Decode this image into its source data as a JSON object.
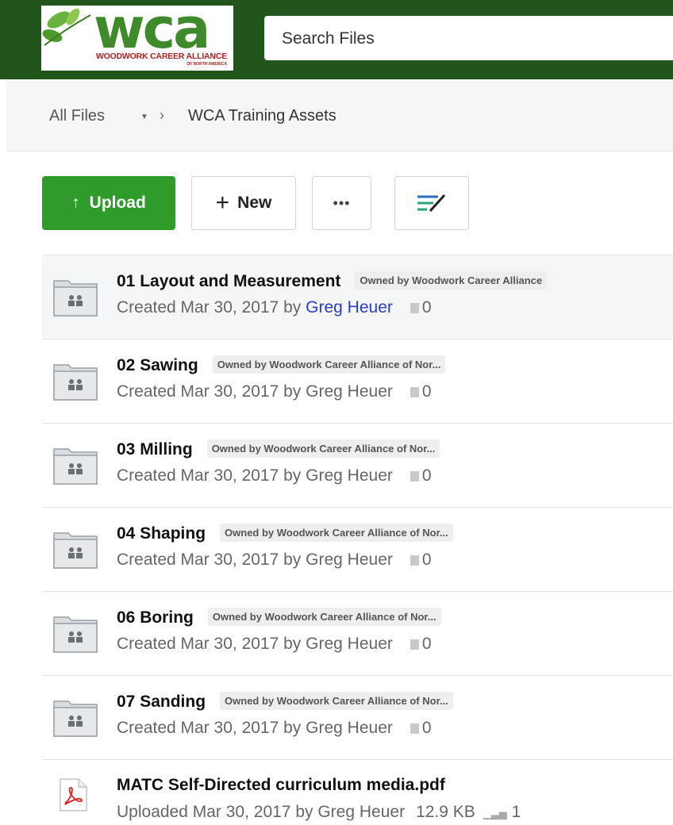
{
  "header": {
    "logo_text": "wca",
    "logo_subtitle": "WOODWORK CAREER ALLIANCE",
    "logo_subtitle2": "OF NORTH AMERICA",
    "search_placeholder": "Search Files",
    "brand_color": "#22551c"
  },
  "breadcrumb": {
    "root": "All Files",
    "separator": "›",
    "current": "WCA Training Assets"
  },
  "toolbar": {
    "upload_label": "Upload",
    "new_label": "New",
    "more_label": "•••"
  },
  "items": [
    {
      "name": "01 Layout and Measurement",
      "owner": "Owned by Woodwork Career Alliance",
      "meta_prefix": "Created Mar 30, 2017 by",
      "author": "Greg Heuer",
      "count": "0",
      "type": "folder"
    },
    {
      "name": "02 Sawing",
      "owner": "Owned by Woodwork Career Alliance of Nor...",
      "meta_prefix": "Created Mar 30, 2017 by",
      "author": "Greg Heuer",
      "count": "0",
      "type": "folder"
    },
    {
      "name": "03 Milling",
      "owner": "Owned by Woodwork Career Alliance of Nor...",
      "meta_prefix": "Created Mar 30, 2017 by",
      "author": "Greg Heuer",
      "count": "0",
      "type": "folder"
    },
    {
      "name": "04 Shaping",
      "owner": "Owned by Woodwork Career Alliance of Nor...",
      "meta_prefix": "Created Mar 30, 2017 by",
      "author": "Greg Heuer",
      "count": "0",
      "type": "folder"
    },
    {
      "name": "06 Boring",
      "owner": "Owned by Woodwork Career Alliance of Nor...",
      "meta_prefix": "Created Mar 30, 2017 by",
      "author": "Greg Heuer",
      "count": "0",
      "type": "folder"
    },
    {
      "name": "07 Sanding",
      "owner": "Owned by Woodwork Career Alliance of Nor...",
      "meta_prefix": "Created Mar 30, 2017 by",
      "author": "Greg Heuer",
      "count": "0",
      "type": "folder"
    },
    {
      "name": "MATC Self-Directed curriculum media.pdf",
      "meta_prefix": "Uploaded Mar 30, 2017 by",
      "author": "Greg Heuer",
      "size": "12.9 KB",
      "views": "1",
      "type": "pdf"
    }
  ]
}
